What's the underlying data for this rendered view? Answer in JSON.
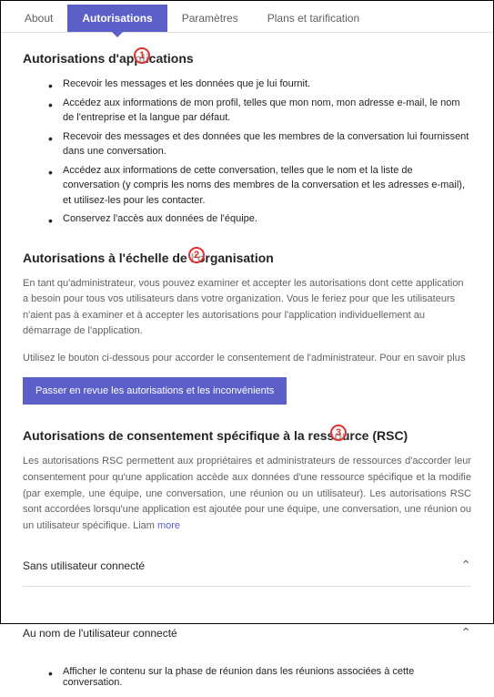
{
  "tabs": {
    "about": "About",
    "autorisations": "Autorisations",
    "parametres": "Paramètres",
    "plans": "Plans et tarification"
  },
  "section1": {
    "title": "Autorisations d'applications",
    "items": [
      "Recevoir les messages et les données que je lui fournit.",
      "Accédez aux informations de mon profil, telles que mon nom, mon adresse e-mail, le nom de l'entreprise et la langue par défaut.",
      "Recevoir des messages et des données que les membres de la conversation lui fournissent dans une conversation.",
      "Accédez aux informations de cette conversation, telles que le nom et la liste de conversation (y compris les noms des membres de la conversation et les adresses e-mail), et utilisez-les pour les contacter.",
      "Conservez l'accès aux données de l'équipe."
    ]
  },
  "section2": {
    "title": "Autorisations à l'échelle de l'organisation",
    "desc1": "En tant qu'administrateur, vous pouvez examiner et accepter les autorisations dont cette application a besoin pour tous vos utilisateurs dans votre organization. Vous le feriez pour que les utilisateurs n'aient pas à examiner et à accepter les autorisations pour l'application individuellement au démarrage de l'application.",
    "desc2": "Utilisez le bouton ci-dessous pour accorder le consentement de l'administrateur. Pour en savoir plus",
    "button": "Passer en revue les autorisations et les inconvénients"
  },
  "section3": {
    "title": "Autorisations de consentement spécifique à la ressource (RSC)",
    "desc": "Les autorisations RSC permettent aux propriétaires et administrateurs de ressources d'accorder leur consentement pour qu'une application accède aux données d'une ressource spécifique et la modifie (par exemple, une équipe, une conversation, une réunion ou un utilisateur). Les autorisations RSC sont accordées lorsqu'une application est ajoutée pour une équipe, une conversation, une réunion ou un utilisateur spécifique. Liam",
    "more": "more",
    "acc1": "Sans utilisateur connecté",
    "acc2": "Au nom de l'utilisateur connecté",
    "acc2_item": "Afficher le contenu sur la phase de réunion dans les réunions associées à cette conversation."
  },
  "callouts": {
    "c1": "1",
    "c2": "2",
    "c3": "3"
  }
}
